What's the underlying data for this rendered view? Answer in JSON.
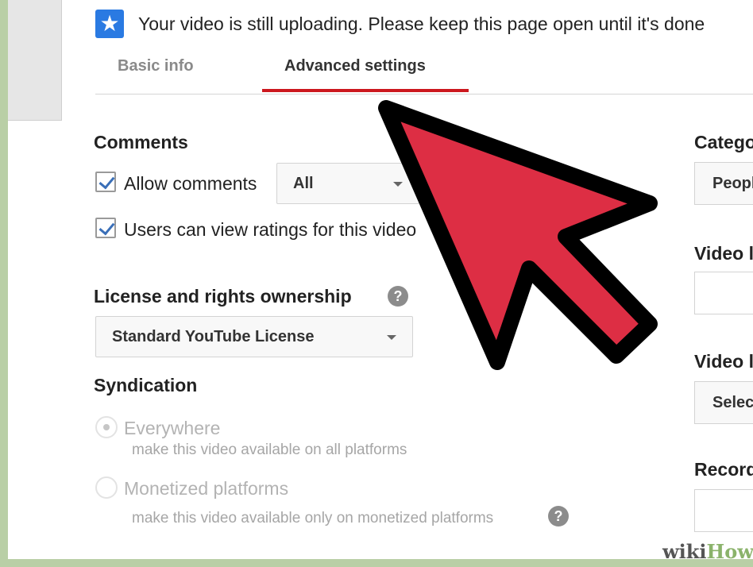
{
  "notice": {
    "icon": "star-icon",
    "text": "Your video is still uploading. Please keep this page open until it's done"
  },
  "tabs": [
    {
      "label": "Basic info",
      "active": false
    },
    {
      "label": "Advanced settings",
      "active": true
    }
  ],
  "comments": {
    "title": "Comments",
    "allow_comments": {
      "label": "Allow comments",
      "checked": true
    },
    "filter_select": {
      "value": "All"
    },
    "ratings": {
      "label": "Users can view ratings for this video",
      "checked": true
    }
  },
  "license": {
    "title": "License and rights ownership",
    "select_value": "Standard YouTube License"
  },
  "syndication": {
    "title": "Syndication",
    "options": [
      {
        "label": "Everywhere",
        "sub": "make this video available on all platforms",
        "selected": true
      },
      {
        "label": "Monetized platforms",
        "sub": "make this video available only on monetized platforms",
        "selected": false
      }
    ]
  },
  "right_column": {
    "category_label": "Category",
    "category_value": "People & Blogs",
    "video_location_label": "Video location",
    "video_language_label": "Video language",
    "video_language_value": "Select language",
    "recording_date_label": "Recording date"
  },
  "watermark": {
    "wiki": "wiki",
    "how": "How"
  },
  "colors": {
    "accent_red": "#cc181e",
    "arrow_red": "#dd2e44",
    "checkbox_blue": "#3a6fb8",
    "badge_blue": "#2a7ae2"
  }
}
